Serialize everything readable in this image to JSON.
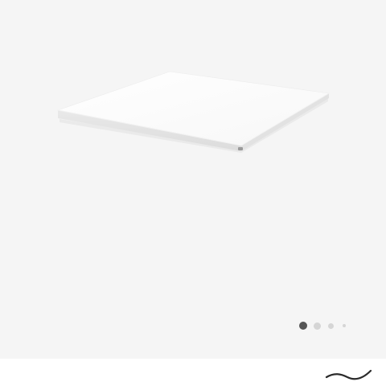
{
  "gallery": {
    "background_color": "#f5f5f5",
    "image": {
      "subject": "mattress-topper",
      "icon": "mattress-topper-image"
    },
    "pagination": {
      "total": 4,
      "active_index": 0,
      "active_color": "#555555",
      "inactive_color": "#d5d5d5"
    }
  },
  "footer": {
    "background_color": "#ffffff",
    "brand_mark": {
      "icon": "wave-logo-icon",
      "color": "#2b2b2b"
    }
  }
}
